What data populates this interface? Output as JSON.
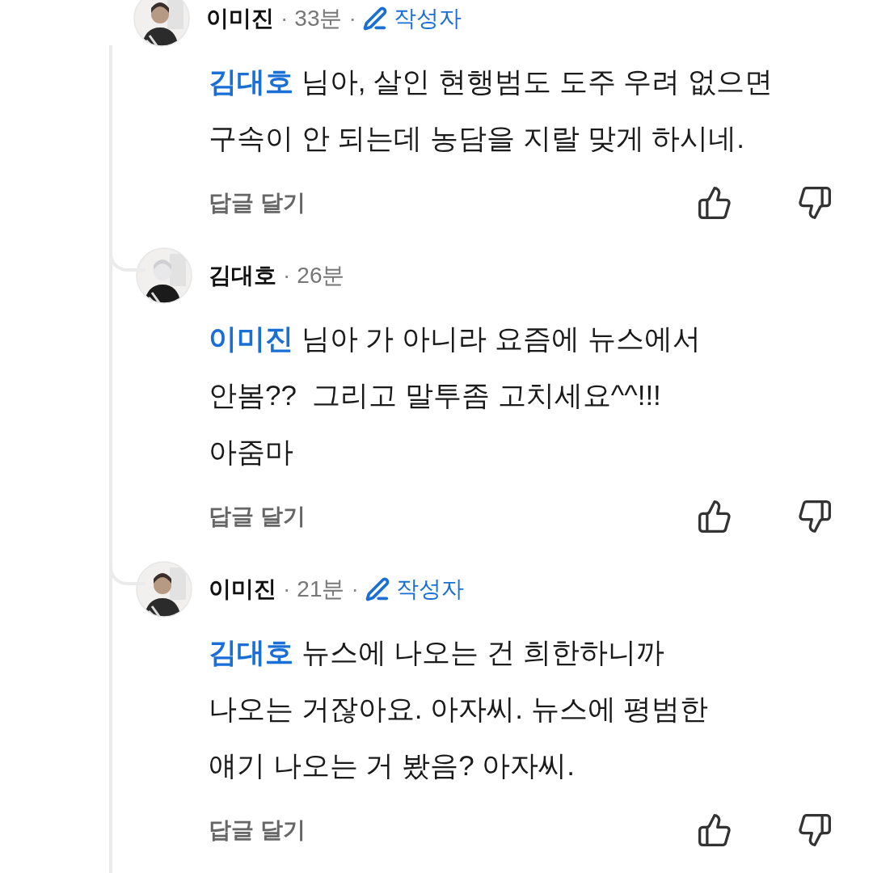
{
  "comment": {
    "author": "이미진",
    "separator": "·",
    "time": "33분",
    "badge": "작성자",
    "mention": "김대호",
    "lines": [
      "님아, 살인 현행범도 도주 우려 없으면",
      "구속이 안 되는데 농담을 지랄 맞게 하시네."
    ],
    "reply_label": "답글 달기"
  },
  "replies": [
    {
      "author": "김대호",
      "separator": "·",
      "time": "26분",
      "mention": "이미진",
      "lines": [
        "님아 가 아니라 요즘에 뉴스에서",
        "안봄??  그리고 말투좀 고치세요^^!!!",
        "아줌마"
      ],
      "reply_label": "답글 달기"
    },
    {
      "author": "이미진",
      "separator": "·",
      "time": "21분",
      "badge": "작성자",
      "mention": "김대호",
      "lines": [
        "뉴스에 나오는 건 희한하니까",
        "나오는 거잖아요. 아자씨. 뉴스에 평범한",
        "얘기 나오는 거 봤음? 아자씨."
      ],
      "reply_label": "답글 달기"
    }
  ]
}
